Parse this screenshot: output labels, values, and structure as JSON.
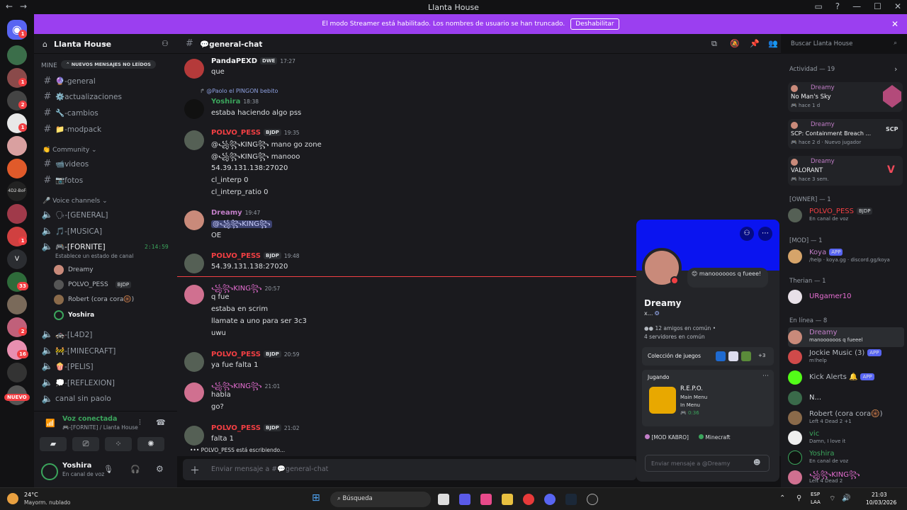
{
  "window": {
    "title": "Llanta House"
  },
  "banner": {
    "text": "El modo Streamer está habilitado. Los nombres de usuario se han truncado.",
    "button": "Deshabilitar"
  },
  "servers": {
    "badges": [
      "1",
      "1",
      "2",
      "1",
      "1",
      "33",
      "2",
      "16",
      "22"
    ],
    "new_label": "NUEVO",
    "text_icons": [
      "4D2-BoF",
      "V"
    ]
  },
  "server": {
    "name": "Llanta House",
    "new_msgs": "NUEVOS MENSAJES NO LEÍDOS",
    "min_label": "MINE"
  },
  "channels": [
    {
      "icon": "hash",
      "label": "🔮-general"
    },
    {
      "icon": "hash",
      "label": "⚙️actualizaciones"
    },
    {
      "icon": "hash",
      "label": "🔧-cambios"
    },
    {
      "icon": "hash",
      "label": "📁-modpack"
    }
  ],
  "category_community": "Community",
  "community_channels": [
    {
      "label": "📹videos"
    },
    {
      "label": "📷fotos"
    }
  ],
  "category_voice": "Voice channels",
  "voice_channels_top": [
    {
      "label": "🗣-[GENERAL]"
    },
    {
      "label": "🎵-[MUSICA]"
    }
  ],
  "fortnite": {
    "label": "🎮-[FORNITE]",
    "timer": "2:14:59",
    "status": "Establece un estado de canal"
  },
  "voice_users": [
    {
      "name": "Dreamy",
      "tag": ""
    },
    {
      "name": "POLVO_PESS",
      "tag": "BJDP"
    },
    {
      "name": "Robert (cora cora🛞)",
      "tag": ""
    },
    {
      "name": "Yoshira",
      "tag": ""
    }
  ],
  "voice_channels_bottom": [
    {
      "label": "🚓-[L4D2]"
    },
    {
      "label": "🚧-[MINECRAFT]"
    },
    {
      "label": "🍿-[PELIS]"
    },
    {
      "label": "💭-[REFLEXION]"
    },
    {
      "label": "canal sin paolo"
    }
  ],
  "voice_panel": {
    "status": "Voz conectada",
    "channel": "🎮-[FORNITE] / Llanta House"
  },
  "user_panel": {
    "name": "Yoshira",
    "status": "En canal de voz"
  },
  "chat": {
    "channel": "💬general-chat",
    "messages": [
      {
        "author": "PandaPEXD",
        "tag": "DWE",
        "time": "17:27",
        "color": "#f2f3f5",
        "lines": [
          "que"
        ]
      },
      {
        "reply": "@Paolo el PINGON bebito",
        "author": "Yoshira",
        "time": "18:38",
        "color": "#3ba55c",
        "lines": [
          "estaba haciendo algo pss"
        ]
      },
      {
        "author": "POLVO_PESS",
        "tag": "BJDP",
        "time": "19:35",
        "color": "#f23f43",
        "lines": [
          "@꧁꧂KING꧂ mano go zone",
          "@꧁꧂KING꧂ manooo",
          "54.39.131.138:27020",
          "cl_interp 0",
          "cl_interp_ratio 0"
        ]
      },
      {
        "author": "Dreamy",
        "time": "19:47",
        "color": "#c27ec8",
        "lines": [
          "@꧁꧂KING꧂",
          "OE"
        ]
      },
      {
        "author": "POLVO_PESS",
        "tag": "BJDP",
        "time": "19:48",
        "color": "#f23f43",
        "lines": [
          "54.39.131.138:27020"
        ]
      },
      {
        "author": "꧁꧂KING꧂",
        "time": "20:57",
        "color": "#e86fd4",
        "lines": [
          "q fue",
          "estaba  en scrim",
          "llamate a uno para ser 3c3",
          "uwu"
        ]
      },
      {
        "author": "POLVO_PESS",
        "tag": "BJDP",
        "time": "20:59",
        "color": "#f23f43",
        "lines": [
          "ya fue falta 1"
        ]
      },
      {
        "author": "꧁꧂KING꧂",
        "time": "21:01",
        "color": "#e86fd4",
        "lines": [
          "habla",
          "go?"
        ]
      },
      {
        "author": "POLVO_PESS",
        "tag": "BJDP",
        "time": "21:02",
        "color": "#f23f43",
        "lines": [
          "falta 1"
        ]
      }
    ],
    "typing": "POLVO_PESS está escribiendo...",
    "composer_placeholder": "Enviar mensaje a #💬general-chat"
  },
  "search": {
    "placeholder": "Buscar Llanta House"
  },
  "members": {
    "activity_header": "Actividad — 19",
    "activities": [
      {
        "user": "Dreamy",
        "game": "No Man's Sky",
        "time": "hace 1 d"
      },
      {
        "user": "Dreamy",
        "game": "SCP: Containment Breach ...",
        "time": "hace 2 d",
        "extra": "Nuevo jugador"
      },
      {
        "user": "Dreamy",
        "game": "VALORANT",
        "time": "hace 3 sem."
      }
    ],
    "groups": [
      {
        "header": "[OWNER] — 1",
        "members": [
          {
            "name": "POLVO_PESS",
            "tag": "BJDP",
            "status": "En canal de voz",
            "color": "#f23f43"
          }
        ]
      },
      {
        "header": "[MOD] — 1",
        "members": [
          {
            "name": "Koya",
            "tag": "APP",
            "status": "/help · koya.gg · discord.gg/koya",
            "color": "#c27ec8"
          }
        ]
      },
      {
        "header": "Therian — 1",
        "members": [
          {
            "name": "URgamer10",
            "status": "",
            "color": "#e86fd4"
          }
        ]
      },
      {
        "header": "En línea — 8",
        "members": [
          {
            "name": "Dreamy",
            "status": "manoooooos q fueeel",
            "color": "#c27ec8"
          },
          {
            "name": "Jockie Music (3)",
            "tag": "APP",
            "status": "m!help",
            "color": "#b5bac1"
          },
          {
            "name": "Kick Alerts 🔔",
            "tag": "APP",
            "status": "",
            "color": "#b5bac1"
          },
          {
            "name": "N...",
            "status": "",
            "color": "#dbdee1"
          },
          {
            "name": "Robert (cora cora🛞)",
            "status": "Left 4 Dead 2 +1",
            "color": "#b5bac1"
          },
          {
            "name": "vic",
            "status": "Damn, I love it",
            "color": "#3ba55c"
          },
          {
            "name": "Yoshira",
            "status": "En canal de voz",
            "color": "#3ba55c"
          },
          {
            "name": "꧁꧂KING꧂",
            "status": "Left 4 Dead 2",
            "color": "#e86fd4"
          }
        ]
      }
    ]
  },
  "popout": {
    "name": "Dreamy",
    "sub": "x...",
    "bubble": "manoooooos q fueee!",
    "mutual": "12 amigos en común •",
    "servers": "4 servidores en común",
    "collection": "Colección de juegos",
    "collection_more": "+3",
    "playing_label": "Jugando",
    "game": "R.E.P.O.",
    "game_detail1": "Main Menu",
    "game_detail2": "In Menu",
    "game_time": "0:36",
    "roles": [
      "[MOD KABRO]",
      "Minecraft"
    ],
    "message_placeholder": "Enviar mensaje a @Dreamy"
  },
  "taskbar": {
    "weather_temp": "24°C",
    "weather_desc": "Mayorm. nublado",
    "search": "Búsqueda",
    "lang": "ESP",
    "lang2": "LAA",
    "time": "21:03",
    "date": "10/03/2026"
  }
}
